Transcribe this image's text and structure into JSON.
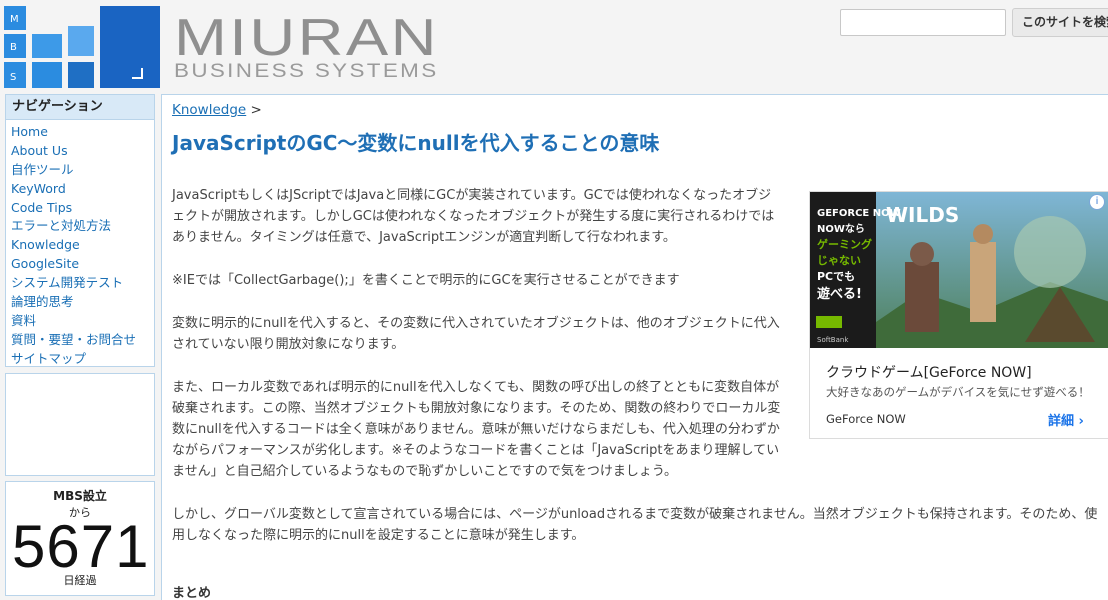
{
  "header": {
    "logo_letters": [
      "M",
      "B",
      "S"
    ],
    "logo_title": "MIURAN",
    "logo_subtitle": "BUSINESS SYSTEMS",
    "search_value": "",
    "search_button_label": "このサイトを検索"
  },
  "sidebar": {
    "nav_title": "ナビゲーション",
    "items": [
      {
        "label": "Home"
      },
      {
        "label": "About Us"
      },
      {
        "label": "自作ツール"
      },
      {
        "label": "KeyWord"
      },
      {
        "label": "Code Tips"
      },
      {
        "label": "エラーと対処方法"
      },
      {
        "label": "Knowledge"
      },
      {
        "label": "GoogleSite"
      },
      {
        "label": "システム開発テスト"
      },
      {
        "label": "論理的思考"
      },
      {
        "label": "資料"
      },
      {
        "label": "質問・要望・お問合せ"
      },
      {
        "label": "サイトマップ"
      }
    ],
    "counter": {
      "heading": "MBS設立",
      "from": "から",
      "days": "5671",
      "unit": "日経過"
    }
  },
  "main": {
    "breadcrumb_link": "Knowledge",
    "breadcrumb_sep": " >",
    "title": "JavaScriptのGC〜変数にnullを代入することの意味",
    "paragraphs": [
      "JavaScriptもしくはJScriptではJavaと同様にGCが実装されています。GCでは使われなくなったオブジェクトが開放されます。しかしGCは使われなくなったオブジェクトが発生する度に実行されるわけではありません。タイミングは任意で、JavaScriptエンジンが適宜判断して行なわれます。",
      "※IEでは「CollectGarbage();」を書くことで明示的にGCを実行させることができます",
      "変数に明示的にnullを代入すると、その変数に代入されていたオブジェクトは、他のオブジェクトに代入されていない限り開放対象になります。",
      "また、ローカル変数であれば明示的にnullを代入しなくても、関数の呼び出しの終了とともに変数自体が破棄されます。この際、当然オブジェクトも開放対象になります。そのため、関数の終わりでローカル変数にnullを代入するコードは全く意味がありません。意味が無いだけならまだしも、代入処理の分わずかながらパフォーマンスが劣化します。※そのようなコードを書くことは「JavaScriptをあまり理解していません」と自己紹介しているようなもので恥ずかしいことですので気をつけましょう。",
      "しかし、グローバル変数として宣言されている場合には、ページがunloadされるまで変数が破棄されません。当然オブジェクトも保持されます。そのため、使用しなくなった際に明示的にnullを設定することに意味が発生します。"
    ],
    "summary_heading": "まとめ"
  },
  "ad": {
    "info_icon": "i",
    "image_text_brand": "GEFORCE NOW",
    "image_text_lines": [
      "NOWなら",
      "ゲーミング",
      "じゃない",
      "PCでも",
      "遊べる!"
    ],
    "image_text_game": "WILDS",
    "image_text_partner": "SoftBank",
    "title": "クラウドゲーム[GeForce NOW]",
    "description": "大好きなあのゲームがデバイスを気にせず遊べる！",
    "brand": "GeForce NOW",
    "cta": "詳細 ›",
    "colors": {
      "accent": "#1a73e8",
      "gfn_green": "#76b900"
    }
  }
}
